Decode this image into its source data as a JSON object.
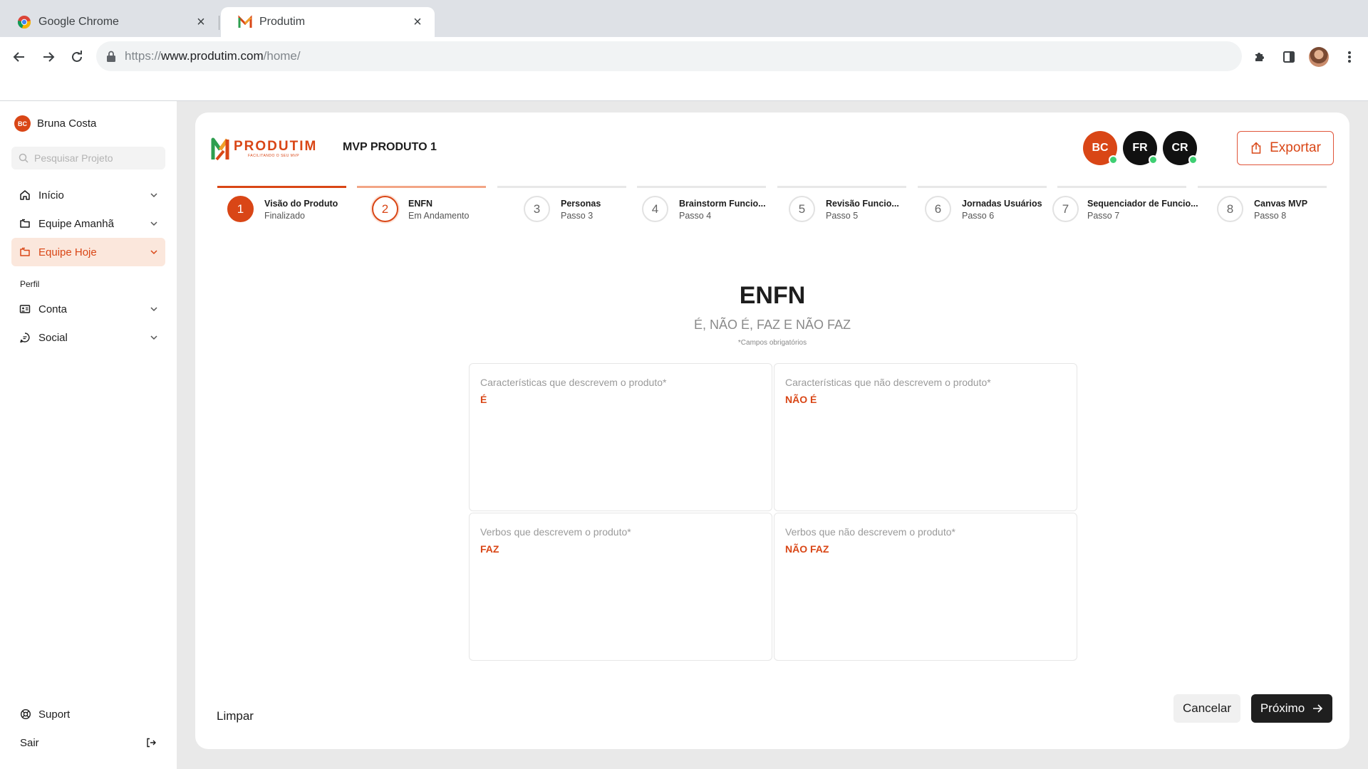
{
  "browser": {
    "tabs": [
      {
        "title": "Google Chrome",
        "active": false
      },
      {
        "title": "Produtim",
        "active": true
      }
    ],
    "url_prefix": "https://",
    "url_host": "www.produtim.com",
    "url_path": "/home/"
  },
  "sidebar": {
    "user": {
      "initials": "BC",
      "name": "Bruna Costa"
    },
    "search_placeholder": "Pesquisar Projeto",
    "items": [
      {
        "label": "Início",
        "icon": "home-icon"
      },
      {
        "label": "Equipe Amanhã",
        "icon": "folder-icon"
      },
      {
        "label": "Equipe Hoje",
        "icon": "folder-icon",
        "active": true
      }
    ],
    "section_label": "Perfil",
    "profile_items": [
      {
        "label": "Conta",
        "icon": "id-card-icon"
      },
      {
        "label": "Social",
        "icon": "chat-icon"
      }
    ],
    "support_label": "Suport",
    "logout_label": "Sair"
  },
  "header": {
    "logo_text": "PRODUTIM",
    "logo_tagline": "FACILITANDO O SEU MVP",
    "project_name": "MVP PRODUTO 1",
    "collaborators": [
      {
        "initials": "BC",
        "color": "#d94616",
        "online": true
      },
      {
        "initials": "FR",
        "color": "#111111",
        "online": true
      },
      {
        "initials": "CR",
        "color": "#111111",
        "online": true
      }
    ],
    "export_label": "Exportar"
  },
  "steps": [
    {
      "number": "1",
      "title": "Visão do Produto",
      "subtitle": "Finalizado",
      "state": "done"
    },
    {
      "number": "2",
      "title": "ENFN",
      "subtitle": "Em Andamento",
      "state": "current"
    },
    {
      "number": "3",
      "title": "Personas",
      "subtitle": "Passo 3",
      "state": "pending"
    },
    {
      "number": "4",
      "title": "Brainstorm Funcio...",
      "subtitle": "Passo 4",
      "state": "pending"
    },
    {
      "number": "5",
      "title": "Revisão Funcio...",
      "subtitle": "Passo 5",
      "state": "pending"
    },
    {
      "number": "6",
      "title": "Jornadas Usuários",
      "subtitle": "Passo 6",
      "state": "pending"
    },
    {
      "number": "7",
      "title": "Sequenciador de Funcio...",
      "subtitle": "Passo 7",
      "state": "pending"
    },
    {
      "number": "8",
      "title": "Canvas MVP",
      "subtitle": "Passo 8",
      "state": "pending"
    }
  ],
  "main": {
    "title": "ENFN",
    "subtitle": "É, NÃO É, FAZ E NÃO FAZ",
    "required_note": "*Campos obrigatórios",
    "fields": [
      {
        "label": "Características que descrevem o produto*",
        "tag": "É",
        "value": ""
      },
      {
        "label": "Características que não descrevem o produto*",
        "tag": "NÃO É",
        "value": ""
      },
      {
        "label": "Verbos que descrevem o produto*",
        "tag": "FAZ",
        "value": ""
      },
      {
        "label": "Verbos que não descrevem o produto*",
        "tag": "NÃO FAZ",
        "value": ""
      }
    ]
  },
  "footer": {
    "clear_label": "Limpar",
    "cancel_label": "Cancelar",
    "next_label": "Próximo"
  },
  "colors": {
    "accent": "#d94616",
    "accent_light": "#fbe7dc",
    "online": "#3ecf72",
    "dark_button": "#1f1f1f"
  }
}
